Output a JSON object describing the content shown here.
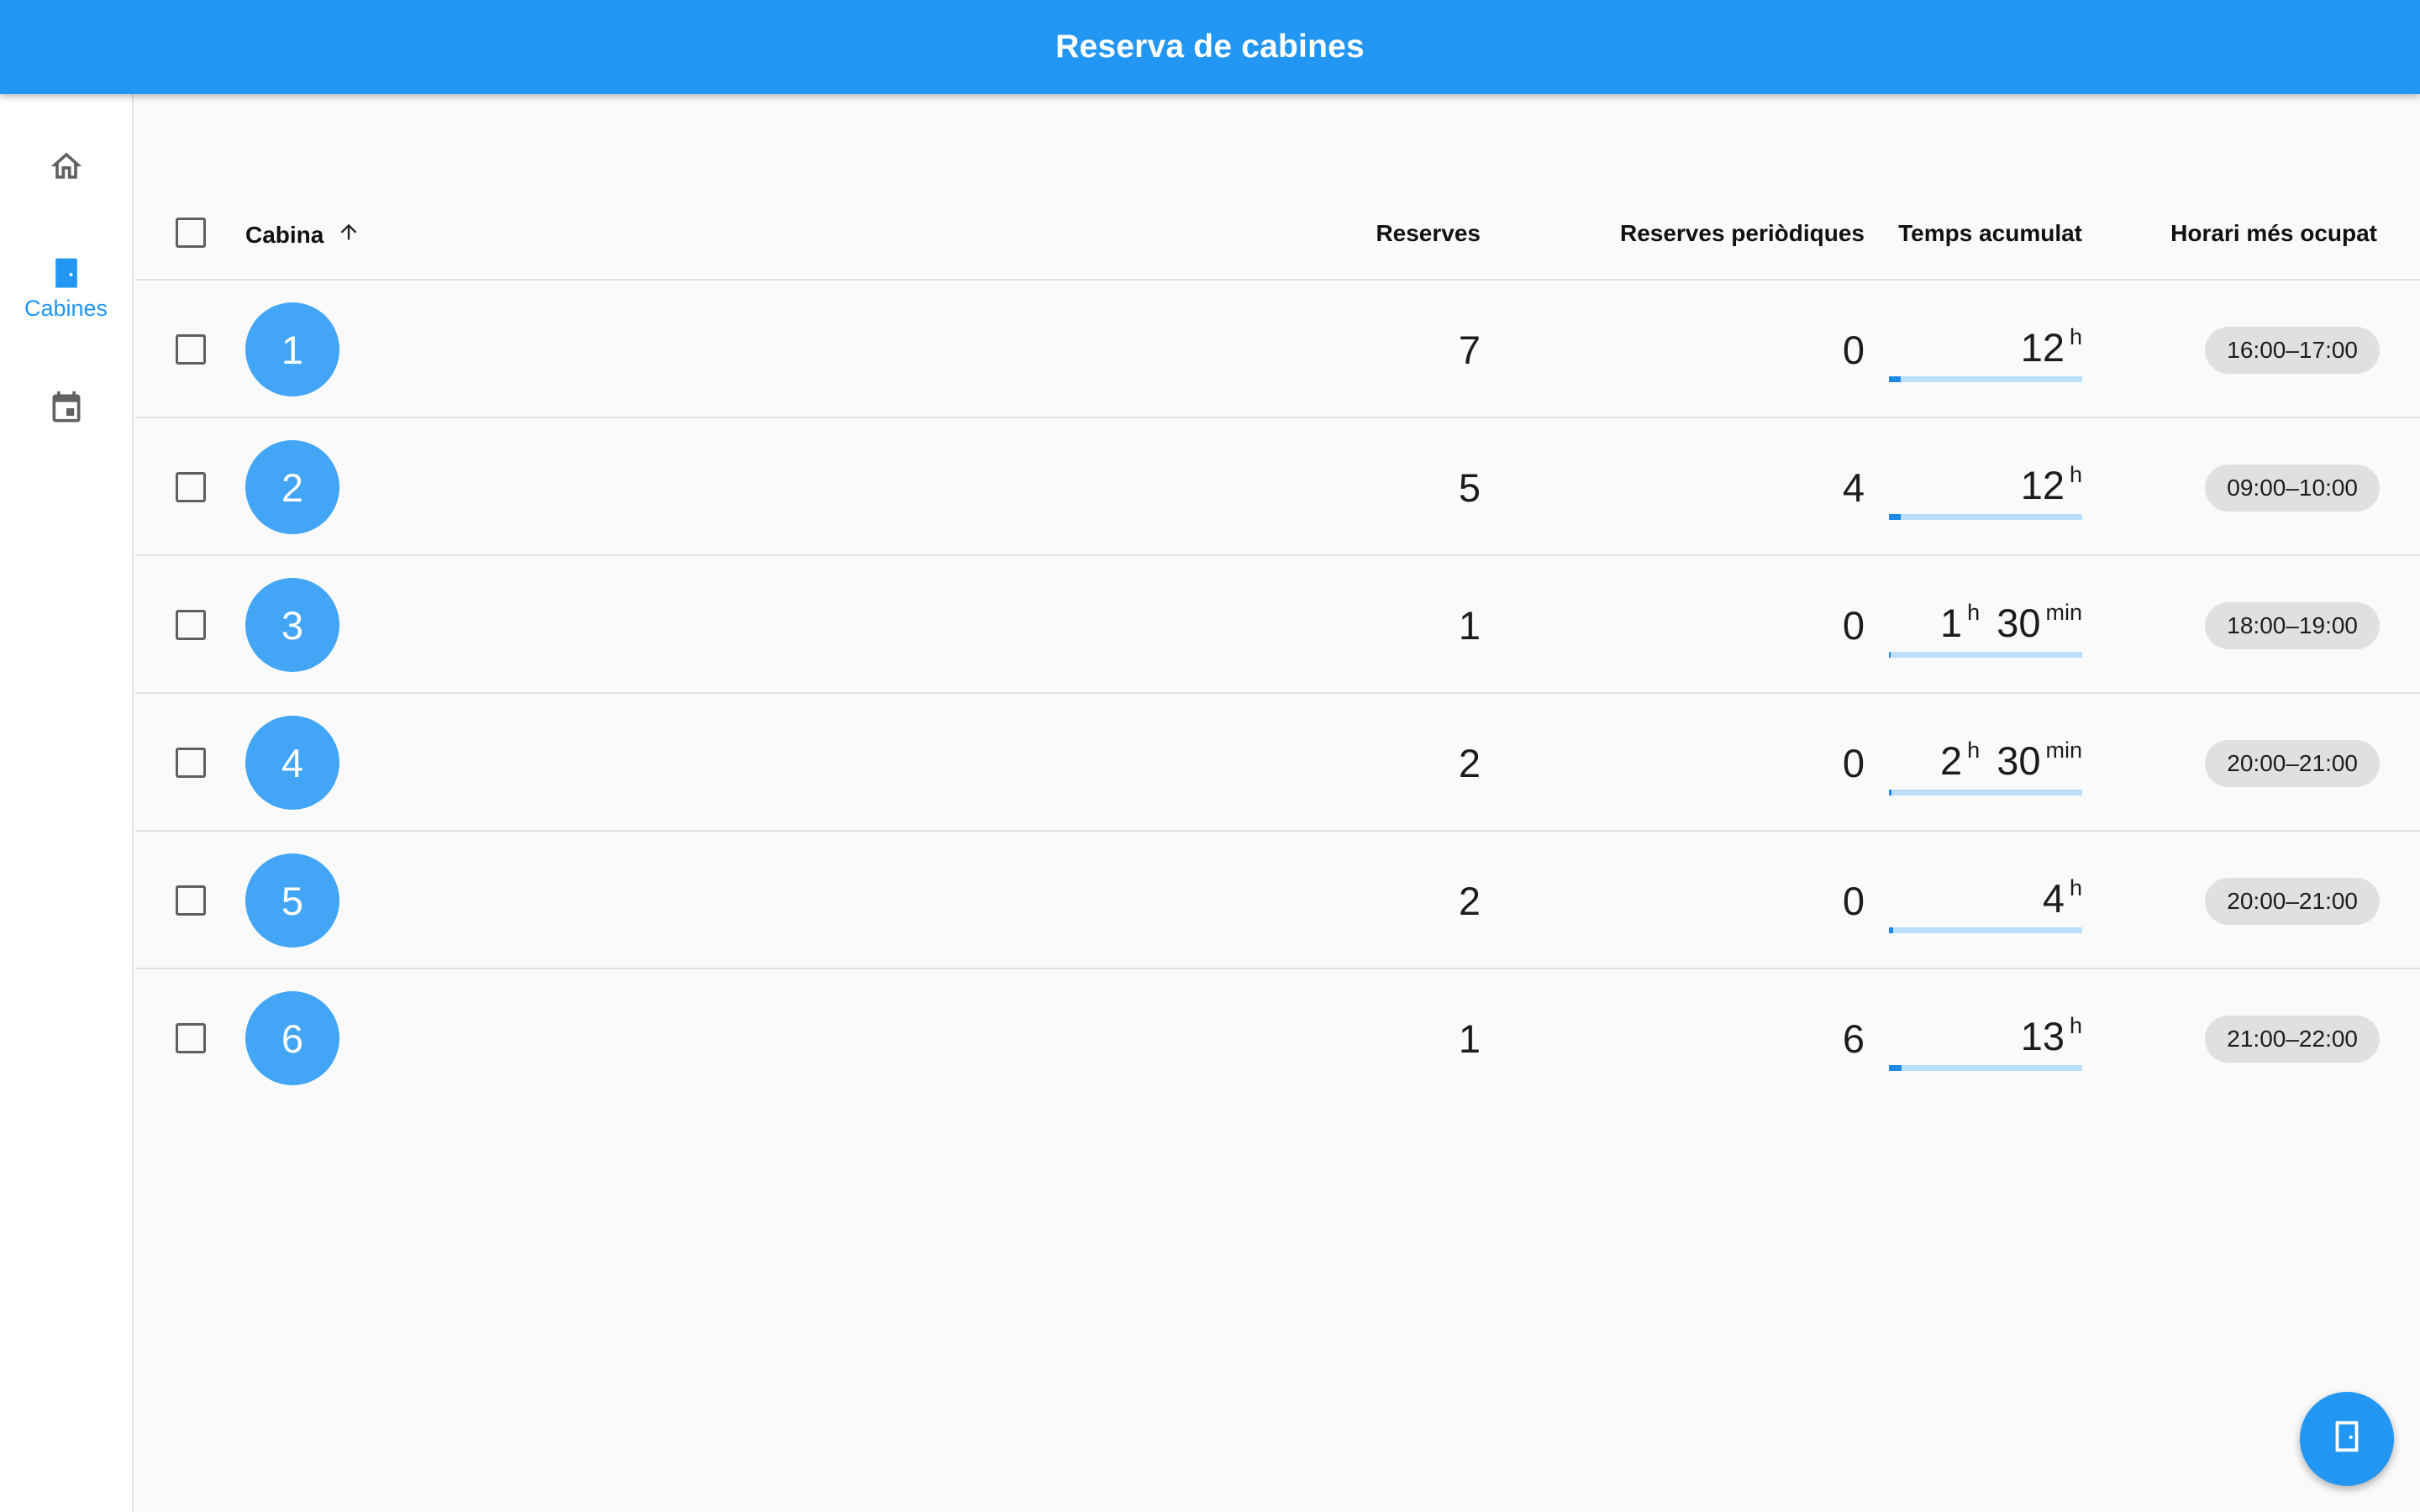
{
  "appbar": {
    "title": "Reserva de cabines"
  },
  "rail": {
    "items": [
      {
        "label": "",
        "icon": "home-icon"
      },
      {
        "label": "Cabines",
        "icon": "door-icon",
        "selected": true
      },
      {
        "label": "",
        "icon": "calendar-icon"
      }
    ]
  },
  "table": {
    "headers": {
      "cabina": "Cabina",
      "reserves": "Reserves",
      "periodiques": "Reserves periòdiques",
      "temps": "Temps acumulat",
      "horari": "Horari més ocupat"
    },
    "sort": {
      "column": "Cabina",
      "direction": "ascending",
      "icon": "arrow-up-icon"
    },
    "rows": [
      {
        "cabina": "1",
        "reserves": "7",
        "periodiques": "0",
        "temps_h": "12",
        "temps_min": "",
        "progress": 0.06,
        "horari": "16:00–17:00"
      },
      {
        "cabina": "2",
        "reserves": "5",
        "periodiques": "4",
        "temps_h": "12",
        "temps_min": "",
        "progress": 0.06,
        "horari": "09:00–10:00"
      },
      {
        "cabina": "3",
        "reserves": "1",
        "periodiques": "0",
        "temps_h": "1",
        "temps_min": "30",
        "progress": 0.01,
        "horari": "18:00–19:00"
      },
      {
        "cabina": "4",
        "reserves": "2",
        "periodiques": "0",
        "temps_h": "2",
        "temps_min": "30",
        "progress": 0.015,
        "horari": "20:00–21:00"
      },
      {
        "cabina": "5",
        "reserves": "2",
        "periodiques": "0",
        "temps_h": "4",
        "temps_min": "",
        "progress": 0.02,
        "horari": "20:00–21:00"
      },
      {
        "cabina": "6",
        "reserves": "1",
        "periodiques": "6",
        "temps_h": "13",
        "temps_min": "",
        "progress": 0.065,
        "horari": "21:00–22:00"
      }
    ],
    "units": {
      "hours": "h",
      "minutes": "min"
    }
  },
  "fab": {
    "icon": "door-icon"
  },
  "colors": {
    "primary": "#2196f3",
    "avatar": "#42a5f5",
    "progress_track": "#bbdefb",
    "progress_fill": "#1e88e5",
    "chip": "#e0e0e0"
  }
}
